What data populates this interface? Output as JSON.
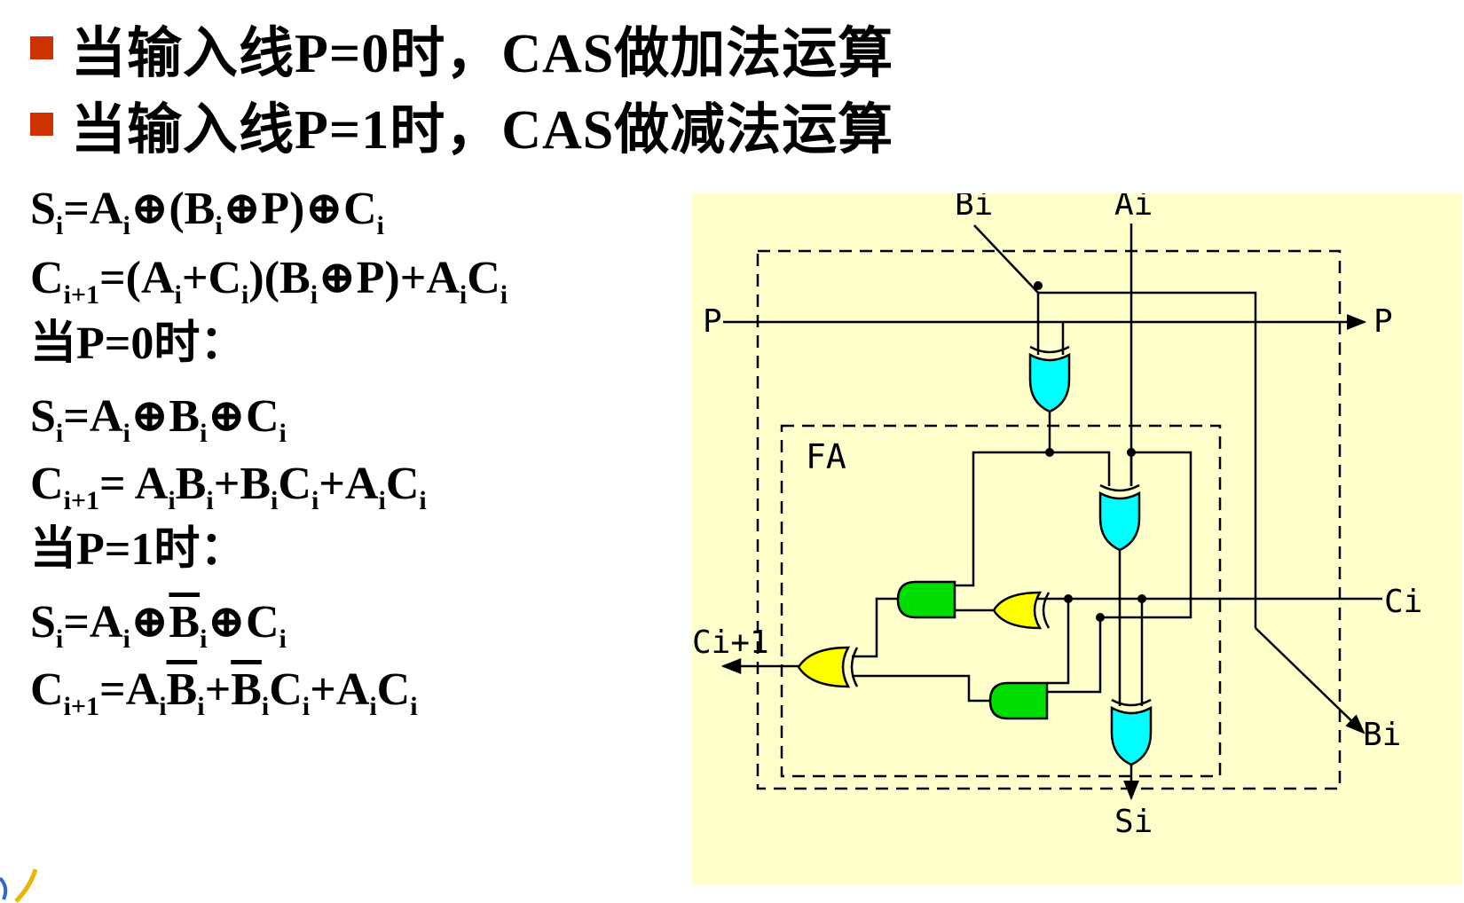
{
  "bullets": [
    {
      "text": "当输入线P=0时，CAS做加法运算"
    },
    {
      "text": "当输入线P=1时，CAS做减法运算"
    }
  ],
  "formulas": {
    "f1": {
      "s": "S",
      "i": "i",
      "eq": "=A",
      "i2": "i",
      "rest1": "⊕(B",
      "i3": "i",
      "rest2": "⊕P)⊕C",
      "i4": "i"
    },
    "f2": {
      "c": "C",
      "ip1": "i+1",
      "eq": "=(A",
      "i1": "i",
      "plus": "+C",
      "i2": "i",
      "mid": ")(B",
      "i3": "i",
      "xp": "⊕P)+A",
      "i4": "i",
      "c2": "C",
      "i5": "i"
    },
    "p0": "当P=0时：",
    "f3": {
      "s": "S",
      "i": "i",
      "eq": "=A",
      "i2": "i",
      "b": "⊕B",
      "i3": "i",
      "c": "⊕C",
      "i4": "i"
    },
    "f4": {
      "c": "C",
      "ip1": "i+1",
      "eq": "= A",
      "i1": "i",
      "b": "B",
      "i2": "i",
      "plus": "+B",
      "i3": "i",
      "c2": "C",
      "i4": "i",
      "plus2": "+A",
      "i5": "i",
      "c3": "C",
      "i6": "i"
    },
    "p1": "当P=1时：",
    "f5": {
      "s": "S",
      "i": "i",
      "eq": "=A",
      "i2": "i",
      "xor": "⊕",
      "b": "B",
      "i3": "i",
      "c": "⊕C",
      "i4": "i"
    },
    "f6": {
      "c": "C",
      "ip1": "i+1",
      "eq": "=A",
      "i1": "i",
      "b": "B",
      "i2": "i",
      "plus": "+",
      "b2": "B",
      "i3": "i",
      "c2": "C",
      "i4": "i",
      "plus2": "+A",
      "i5": "i",
      "c3": "C",
      "i6": "i"
    }
  },
  "circuit": {
    "labels": {
      "bi_in": "Bi",
      "ai_in": "Ai",
      "p_in": "P",
      "p_out": "P",
      "fa": "FA",
      "ci_in": "Ci",
      "ci1_out": "Ci+1",
      "bi_out": "Bi",
      "si_out": "Si"
    },
    "colors": {
      "background": "#ffffcc",
      "xor_gate": "#00ffff",
      "and_gate": "#00dd00",
      "or_gate": "#ffff00",
      "line": "#000000"
    }
  }
}
